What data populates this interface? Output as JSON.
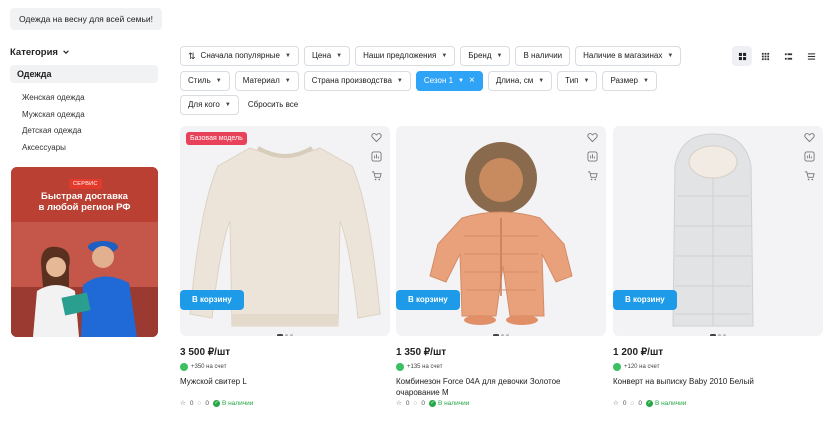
{
  "promo_chip": "Одежда на весну для всей семьи!",
  "sidebar": {
    "heading": "Категория",
    "active": "Одежда",
    "items": [
      "Женская одежда",
      "Мужская одежда",
      "Детская одежда",
      "Аксессуары"
    ]
  },
  "banner": {
    "badge": "СЕРВИС",
    "title_line1": "Быстрая доставка",
    "title_line2": "в любой регион РФ"
  },
  "filters": {
    "sort": "Сначала популярные",
    "price": "Цена",
    "offers": "Наши предложения",
    "brand": "Бренд",
    "in_stock": "В наличии",
    "in_stores": "Наличие в магазинах",
    "style": "Стиль",
    "material": "Материал",
    "country": "Страна производства",
    "season": "Сезон 1",
    "length": "Длина, см",
    "type": "Тип",
    "size": "Размер",
    "for_whom": "Для кого",
    "reset": "Сбросить все"
  },
  "products": [
    {
      "tag": "Базовая модель",
      "price": "3 500 ₽/шт",
      "bonus": "+350 на счет",
      "name": "Мужской свитер L",
      "likes": "0",
      "comments": "0",
      "stock": "В наличии",
      "cart": "В корзину"
    },
    {
      "price": "1 350 ₽/шт",
      "bonus": "+135 на счет",
      "name": "Комбинезон Force 04А для девочки Золотое очарование М",
      "likes": "0",
      "comments": "0",
      "stock": "В наличии",
      "cart": "В корзину"
    },
    {
      "price": "1 200 ₽/шт",
      "bonus": "+120 на счет",
      "name": "Конверт на выписку Baby 2010 Белый",
      "likes": "0",
      "comments": "0",
      "stock": "В наличии",
      "cart": "В корзину"
    }
  ],
  "colors": {
    "accent": "#2fa3f5",
    "button": "#1e9be8",
    "in_stock": "#25a845",
    "tag": "#e8425a"
  }
}
